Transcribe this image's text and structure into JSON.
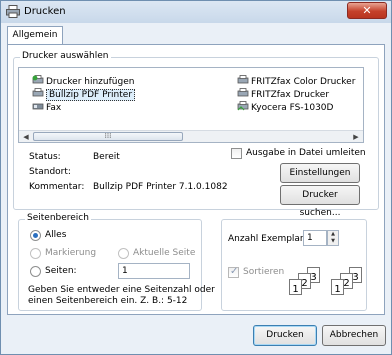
{
  "window": {
    "title": "Drucken",
    "close_label": "✕"
  },
  "tabs": [
    {
      "label": "Allgemein"
    }
  ],
  "printer_group": {
    "legend": "Drucker auswählen",
    "items": [
      {
        "label": "Drucker hinzufügen",
        "icon": "add-printer-icon"
      },
      {
        "label": "Bullzip PDF Printer",
        "icon": "printer-icon",
        "selected": true
      },
      {
        "label": "Fax",
        "icon": "fax-icon"
      },
      {
        "label": "FRITZfax Color Drucker",
        "icon": "printer-icon"
      },
      {
        "label": "FRITZfax Drucker",
        "icon": "printer-icon"
      },
      {
        "label": "Kyocera FS-1030D",
        "icon": "network-printer-icon"
      }
    ],
    "status_label": "Status:",
    "status_value": "Bereit",
    "location_label": "Standort:",
    "location_value": "",
    "comment_label": "Kommentar:",
    "comment_value": "Bullzip PDF Printer 7.1.0.1082",
    "print_to_file_label": "Ausgabe in Datei umleiten",
    "preferences_button": "Einstellungen",
    "find_printer_button": "Drucker suchen..."
  },
  "range_group": {
    "legend": "Seitenbereich",
    "all_label": "Alles",
    "selection_label": "Markierung",
    "current_page_label": "Aktuelle Seite",
    "pages_label": "Seiten:",
    "pages_value": "1",
    "hint_line1": "Geben Sie entweder eine Seitenzahl oder",
    "hint_line2": "einen Seitenbereich ein. Z. B.: 5-12"
  },
  "copies_group": {
    "copies_label": "Anzahl Exemplare:",
    "copies_value": "1",
    "collate_label": "Sortieren",
    "collated_pages": [
      "1",
      "2",
      "3"
    ],
    "uncollated_pages": [
      "1",
      "2",
      "3"
    ]
  },
  "footer": {
    "print_button": "Drucken",
    "cancel_button": "Abbrechen"
  }
}
